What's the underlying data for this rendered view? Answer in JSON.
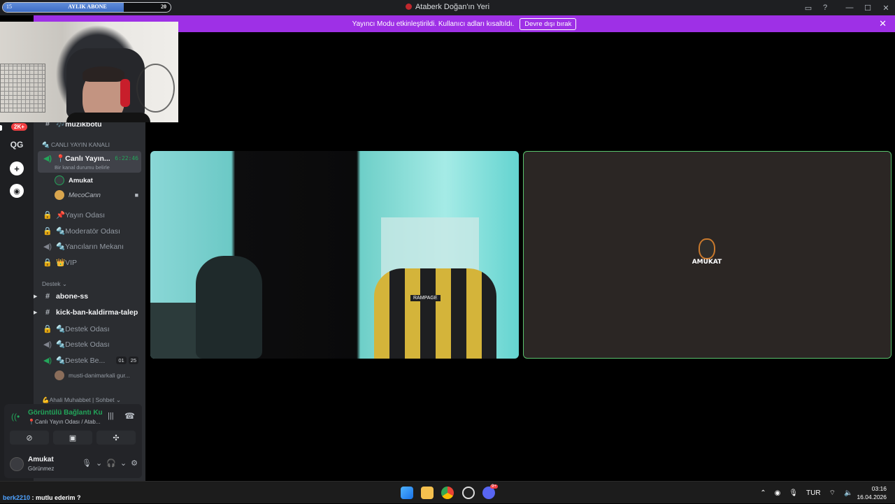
{
  "subscription_bar": {
    "left_value": "15",
    "label": "AYLIK ABONE",
    "right_value": "20",
    "progress_fraction": 0.72
  },
  "window": {
    "title": "Ataberk Doğan'ın Yeri"
  },
  "banner": {
    "message": "Yayıncı Modu etkinleştirildi. Kullanıcı adları kısaltıldı.",
    "button_label": "Devre dışı bırak"
  },
  "rail": {
    "badge": "2K+",
    "server_abbrev": "QG"
  },
  "sidebar": {
    "top_channel": "🎶muzikbotu",
    "category_live": "🔩 CANLI YAYIN KANALI",
    "active_channel": {
      "name": "📍Canlı Yayın...",
      "timer": "6:22:46",
      "status": "Bir kanal durumu belirle"
    },
    "voice_users": [
      {
        "name": "Amukat"
      },
      {
        "name": "MecoCann"
      }
    ],
    "channels_a": [
      "📌Yayın Odası",
      "🔩Moderatör Odası",
      "🔩Yancıların Mekanı",
      "👑VIP"
    ],
    "category_support": "Destek",
    "text_channels": [
      "abone-ss",
      "kick-ban-kaldirma-talep"
    ],
    "channels_b": [
      "🔩Destek Odası",
      "🔩Destek Odası",
      "🔩Destek Be..."
    ],
    "destek_counts": [
      "01",
      "25"
    ],
    "destek_user": "musti-danimarkali gur...",
    "category_social": "💪Ahali Muhabbet | Sohbet"
  },
  "voice_panel": {
    "connection": "Görüntülü Bağlantı Ku",
    "connection_sub": "📍Canlı Yayın Odası / Atab...",
    "username": "Amukat",
    "user_status": "Görünmez"
  },
  "stage": {
    "right_tile_name": "AMUKAT",
    "left_chair_brand": "RAMPAGE"
  },
  "taskbar": {
    "chat_user": "berk2210",
    "chat_text": " : mutlu ederim ?",
    "lang": "TUR",
    "time": "03:16",
    "date": "16.04.2026",
    "discord_badge": "9+"
  },
  "colors": {
    "accent_purple": "#9e30e6",
    "online_green": "#23a55a",
    "tile_border": "#5ac46e"
  }
}
